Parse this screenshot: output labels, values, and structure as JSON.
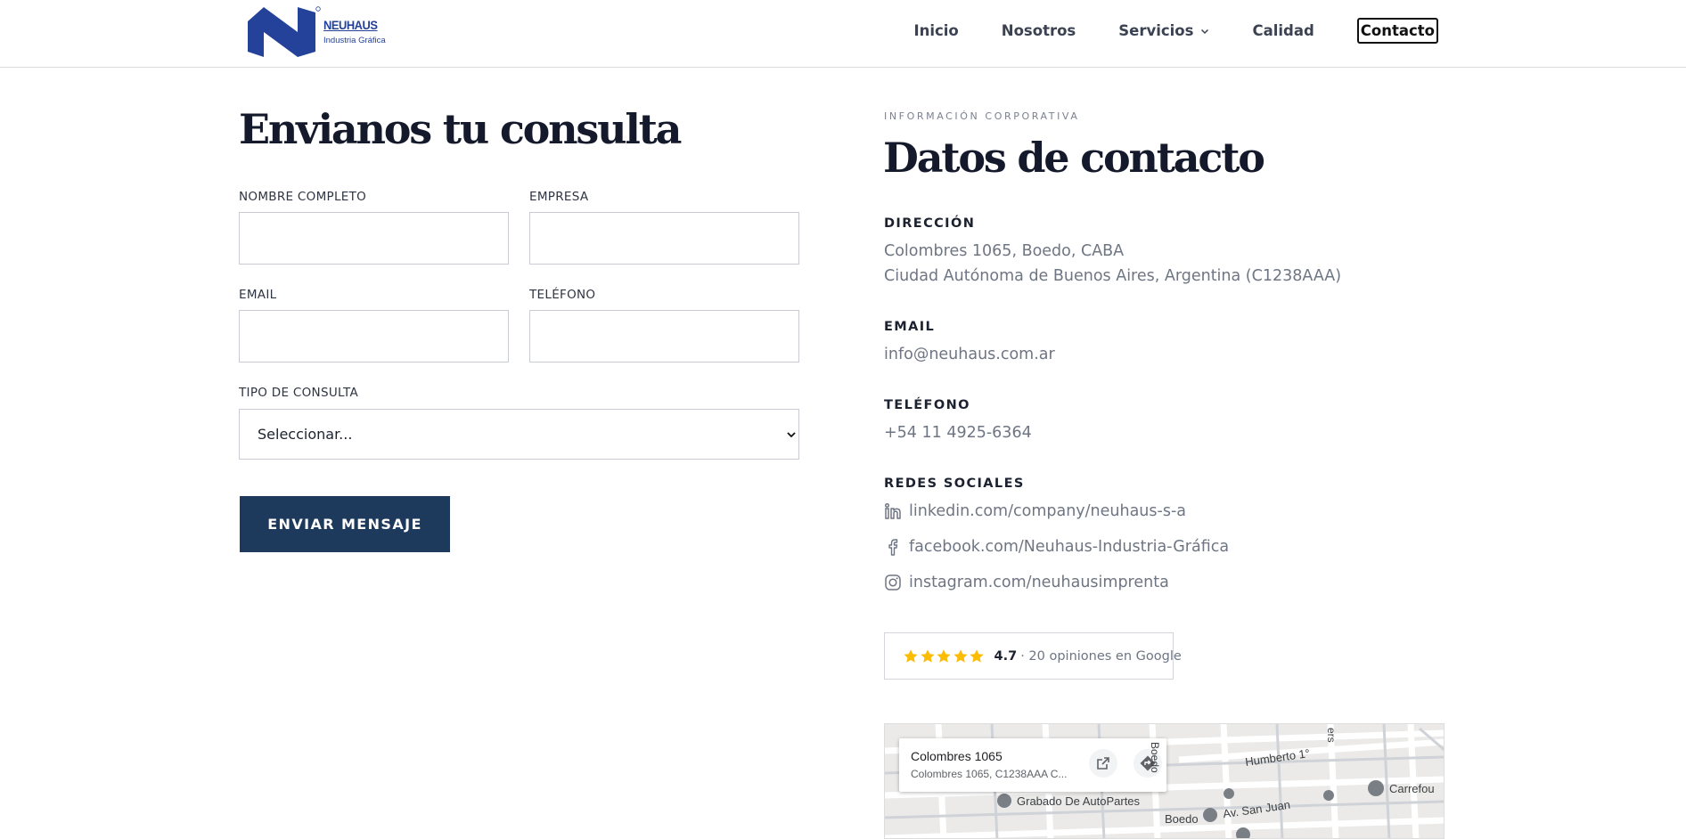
{
  "header": {
    "logo_word": "NEUHAUS",
    "logo_sub": "Industria Gráfica",
    "nav": [
      {
        "label": "Inicio"
      },
      {
        "label": "Nosotros"
      },
      {
        "label": "Servicios"
      },
      {
        "label": "Calidad"
      },
      {
        "label": "Contacto"
      }
    ]
  },
  "form": {
    "title": "Envianos tu consulta",
    "name_label": "NOMBRE COMPLETO",
    "company_label": "EMPRESA",
    "email_label": "EMAIL",
    "phone_label": "TELÉFONO",
    "type_label": "TIPO DE CONSULTA",
    "type_selected": "Seleccionar...",
    "submit_label": "ENVIAR MENSAJE"
  },
  "contact": {
    "eyebrow": "INFORMACIÓN CORPORATIVA",
    "title": "Datos de contacto",
    "address_label": "DIRECCIÓN",
    "address_line1": "Colombres 1065, Boedo, CABA",
    "address_line2": "Ciudad Autónoma de Buenos Aires, Argentina (C1238AAA)",
    "email_label": "EMAIL",
    "email": "info@neuhaus.com.ar",
    "phone_label": "TELÉFONO",
    "phone": "+54 11 4925-6364",
    "social_label": "REDES SOCIALES",
    "social": [
      {
        "icon": "linkedin-icon",
        "text": "linkedin.com/company/neuhaus-s-a"
      },
      {
        "icon": "facebook-icon",
        "text": "facebook.com/Neuhaus-Industria-Gráfica"
      },
      {
        "icon": "instagram-icon",
        "text": "instagram.com/neuhausimprenta"
      }
    ],
    "rating_value": "4.7",
    "rating_text": "· 20 opiniones en Google",
    "rating_stars": 5
  },
  "map": {
    "card_title": "Colombres 1065",
    "card_subtitle": "Colombres 1065, C1238AAA C...",
    "labels": {
      "grabado": "Grabado De AutoPartes",
      "humberto": "Humberto 1°",
      "carrefour": "Carrefou",
      "boedo_street": "Boedo",
      "boedo_area": "Boedo",
      "san_juan": "Av. San Juan",
      "ers": "ers"
    }
  },
  "colors": {
    "primary": "#1d3a5c",
    "logo_blue": "#24429a",
    "star": "#fbbc04",
    "text_muted": "#6e7583"
  }
}
